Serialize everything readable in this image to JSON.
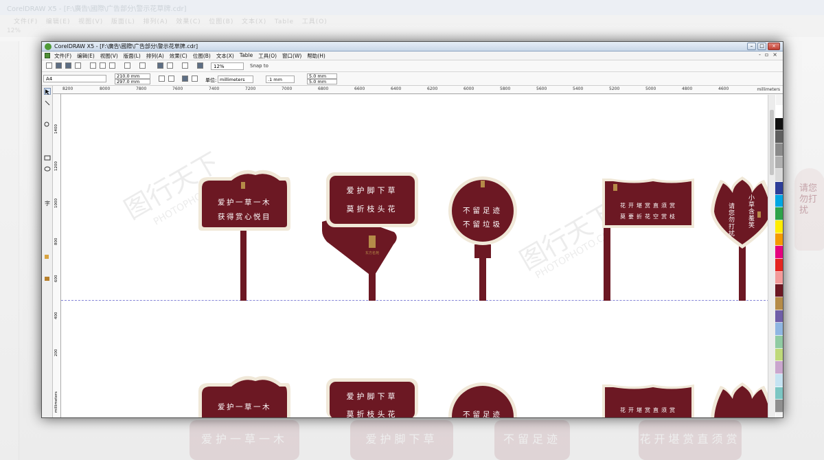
{
  "background": {
    "title": "CorelDRAW X5 - [F:\\廣告\\國際\\广告部分\\警示花草牌.cdr]",
    "menu_items": [
      "文件(F)",
      "编辑(E)",
      "视图(V)",
      "版面(L)",
      "排列(A)",
      "效果(C)",
      "位图(B)",
      "文本(X)",
      "Table",
      "工具(O)"
    ],
    "toolbar_text": "12%"
  },
  "window": {
    "title": "CorelDRAW X5 - [F:\\廣告\\國際\\广告部分\\警示花草牌.cdr]",
    "controls": [
      "–",
      "□",
      "×"
    ]
  },
  "menu": {
    "items": [
      "文件(F)",
      "编辑(E)",
      "视图(V)",
      "版面(L)",
      "排列(A)",
      "效果(C)",
      "位图(B)",
      "文本(X)",
      "Table",
      "工具(O)",
      "窗口(W)",
      "帮助(H)"
    ]
  },
  "toolbar": {
    "zoom": "12%",
    "snap_to": "Snap to"
  },
  "property_bar": {
    "page_size": "A4",
    "width": "210.0 mm",
    "height": "297.0 mm",
    "units_label": "单位:",
    "units": "millimeters",
    "nudge": ".1 mm",
    "dup_x": "5.0 mm",
    "dup_y": "5.0 mm"
  },
  "ruler": {
    "top_ticks": [
      "8200",
      "8000",
      "7800",
      "7600",
      "7400",
      "7200",
      "7000",
      "6800",
      "6600",
      "6400",
      "6200",
      "6000",
      "5800",
      "5600",
      "5400",
      "5200",
      "5000",
      "4800",
      "4600"
    ],
    "unit": "millimeters",
    "left_ticks": [
      "1400",
      "1200",
      "1000",
      "800",
      "600",
      "400",
      "200"
    ],
    "left_unit": "millimeters"
  },
  "signs": {
    "sign1_line1": "爱护一草一木",
    "sign1_line2": "获得赏心悦目",
    "sign2_line1": "爱护脚下草",
    "sign2_line2": "莫折枝头花",
    "sign2_brand": "东方名苑",
    "sign3_line1": "不留足迹",
    "sign3_line2": "不留垃圾",
    "sign4_line1": "花开堪赏直须赏",
    "sign4_line2": "莫要折花空赏枝",
    "sign5_left": "请您勿打扰",
    "sign5_right": "小草含羞笑",
    "bottom_sign3": "不留足迹"
  },
  "watermarks": {
    "cn": "图行天下",
    "en": "PHOTOPHOTO.CN"
  },
  "colors": {
    "maroon": "#6c1823",
    "cream_border": "#f0e8d8",
    "gold": "#b58b48"
  }
}
